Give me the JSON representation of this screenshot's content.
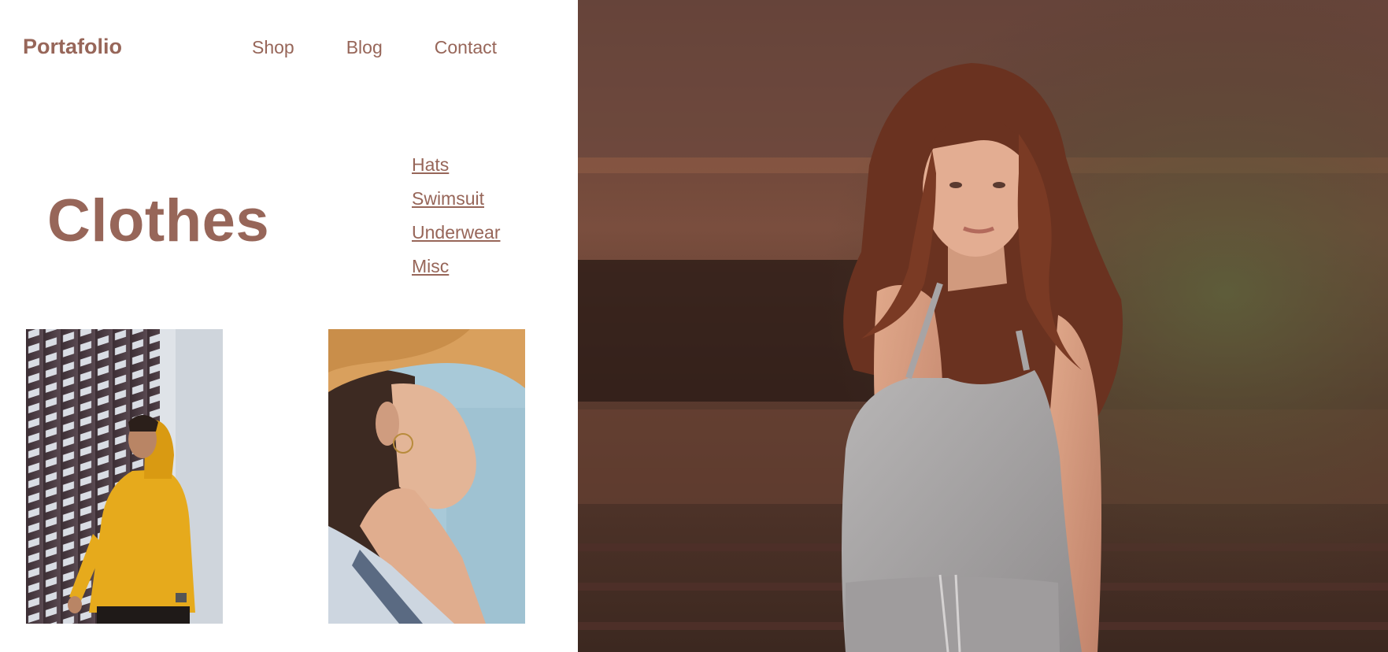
{
  "brand": {
    "name": "Portafolio"
  },
  "nav": {
    "items": [
      "Shop",
      "Blog",
      "Contact"
    ]
  },
  "page": {
    "title": "Clothes"
  },
  "categories": [
    "Hats",
    "Swimsuit",
    "Underwear",
    "Misc"
  ],
  "gallery": [
    {
      "icon": "photo-man-yellow-hoodie"
    },
    {
      "icon": "photo-woman-straw-hat"
    }
  ],
  "hero": {
    "icon": "photo-woman-grey-dress"
  },
  "colors": {
    "accent": "#976659",
    "background": "#ffffff"
  }
}
